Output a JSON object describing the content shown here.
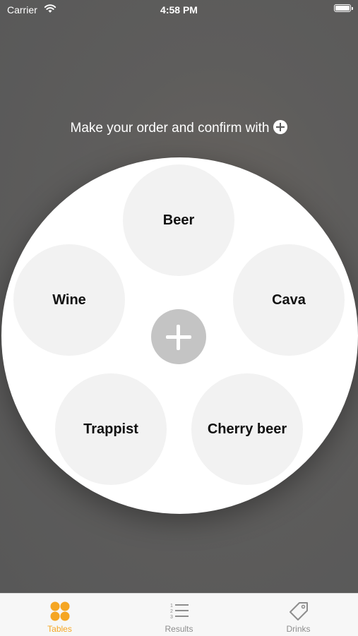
{
  "status_bar": {
    "carrier": "Carrier",
    "time": "4:58 PM"
  },
  "instruction": {
    "text": "Make your order and confirm with"
  },
  "drinks": [
    {
      "label": "Beer"
    },
    {
      "label": "Wine"
    },
    {
      "label": "Cava"
    },
    {
      "label": "Trappist"
    },
    {
      "label": "Cherry beer"
    }
  ],
  "tabs": [
    {
      "label": "Tables",
      "icon": "tables-grid-icon",
      "active": true
    },
    {
      "label": "Results",
      "icon": "numbered-list-icon",
      "active": false
    },
    {
      "label": "Drinks",
      "icon": "tag-icon",
      "active": false
    }
  ],
  "colors": {
    "accent": "#f5a623",
    "background": "#5b5b5b",
    "drink_circle": "#f2f2f2",
    "confirm_button": "#c4c4c4"
  }
}
